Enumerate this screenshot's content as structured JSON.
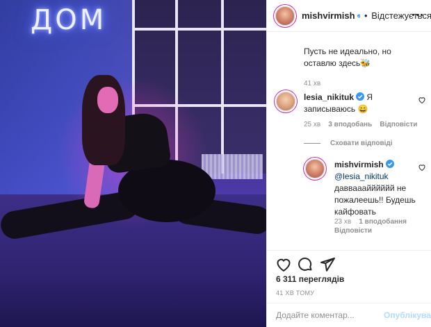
{
  "post": {
    "neon_sign": "ДОМ",
    "author": "mishvirmish",
    "follow_label": "Відстежується",
    "caption": "Пусть не идеально, но оставлю здесь🐝",
    "caption_time": "41 хв"
  },
  "comments": [
    {
      "user": "lesia_nikituk",
      "text": "Я записываюсь 😄",
      "time": "25 хв",
      "likes": "3 вподобань",
      "reply_label": "Відповісти",
      "hide_replies": "Сховати відповіді",
      "replies": [
        {
          "user": "mishvirmish",
          "mention": "@lesia_nikituk",
          "text": "даввааайййййй не пожалеешь!! Будешь кайфовать",
          "time": "23 хв",
          "likes": "1 вподобання",
          "reply_label": "Відповісти"
        }
      ]
    }
  ],
  "stats": {
    "views": "6 311 переглядів",
    "posted": "41 ХВ ТОМУ"
  },
  "composer": {
    "placeholder": "Додайте коментар...",
    "post_label": "Опублікувати"
  },
  "icons": {
    "verified": "verified-badge-icon",
    "more": "more-options-icon",
    "like": "heart-icon",
    "comment": "comment-bubble-icon",
    "share": "paper-plane-icon",
    "comment_like": "small-heart-icon"
  },
  "colors": {
    "verified_blue": "#3897f0",
    "link_blue": "#00376b",
    "muted": "#8e8e8e",
    "disabled_blue": "#b3dbff"
  }
}
